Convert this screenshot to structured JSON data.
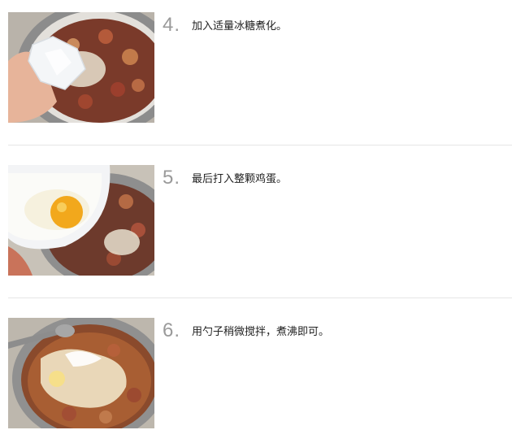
{
  "steps": [
    {
      "number": "4.",
      "text": "加入适量冰糖煮化。",
      "image": "rock-sugar-added-to-pot-photo"
    },
    {
      "number": "5.",
      "text": "最后打入整颗鸡蛋。",
      "image": "egg-poured-into-pot-photo"
    },
    {
      "number": "6.",
      "text": "用勺子稍微搅拌，煮沸即可。",
      "image": "stirring-soup-with-ladle-photo"
    }
  ]
}
